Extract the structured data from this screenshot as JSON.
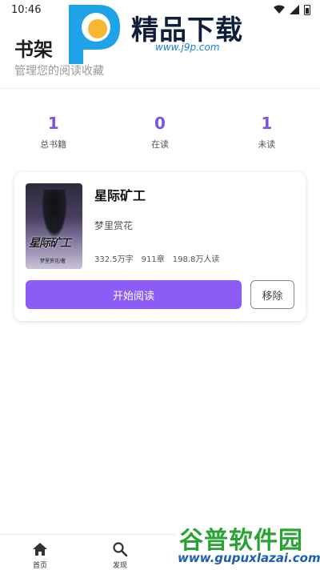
{
  "status_bar": {
    "time": "10:46"
  },
  "header": {
    "title": "书架",
    "subtitle": "管理您的阅读收藏"
  },
  "watermark_top": {
    "title": "精品下载",
    "url": "www.j9p.com"
  },
  "stats": [
    {
      "value": "1",
      "label": "总书籍"
    },
    {
      "value": "0",
      "label": "在读"
    },
    {
      "value": "1",
      "label": "未读"
    }
  ],
  "book": {
    "title": "星际矿工",
    "author": "梦里赏花",
    "words": "332.5万字",
    "chapters": "911章",
    "readers": "198.8万人读",
    "cover_text": "星际矿工",
    "cover_author": "梦里赏花/著",
    "read_label": "开始阅读",
    "remove_label": "移除"
  },
  "nav": [
    {
      "label": "首页",
      "icon": "home-icon"
    },
    {
      "label": "发现",
      "icon": "search-icon"
    }
  ],
  "watermark_bottom": {
    "title": "谷普软件园",
    "url": "www.gupuxlazai.com"
  },
  "colors": {
    "accent": "#8b5cf6",
    "stat_value": "#7c54e0"
  }
}
